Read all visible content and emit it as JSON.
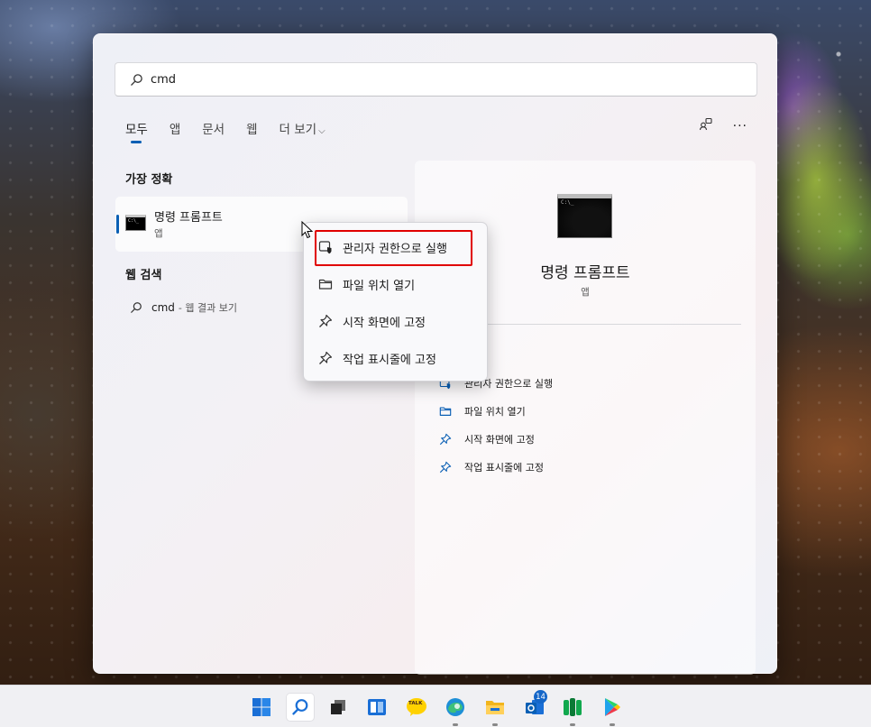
{
  "search": {
    "query": "cmd"
  },
  "tabs": [
    {
      "label": "모두",
      "active": true
    },
    {
      "label": "앱"
    },
    {
      "label": "문서"
    },
    {
      "label": "웹"
    },
    {
      "label": "더 보기",
      "chevron": "⌵"
    }
  ],
  "header_actions": {
    "share_icon": "share-icon",
    "more_label": "···"
  },
  "best_match": {
    "section_title": "가장 정확",
    "title": "명령 프롬프트",
    "subtitle": "앱",
    "icon_text": "C:\\_"
  },
  "web_search": {
    "section_title": "웹 검색",
    "query": "cmd",
    "suffix": "- 웹 결과 보기"
  },
  "preview": {
    "title": "명령 프롬프트",
    "subtitle": "앱",
    "icon_text": "C:\\_",
    "actions": [
      {
        "label": "관리자 권한으로 실행",
        "icon": "shield-icon"
      },
      {
        "label": "파일 위치 열기",
        "icon": "folder-icon"
      },
      {
        "label": "시작 화면에 고정",
        "icon": "pin-icon"
      },
      {
        "label": "작업 표시줄에 고정",
        "icon": "pin-icon"
      }
    ]
  },
  "context_menu": {
    "items": [
      {
        "label": "관리자 권한으로 실행",
        "icon": "shield-icon",
        "highlighted": true
      },
      {
        "label": "파일 위치 열기",
        "icon": "folder-icon"
      },
      {
        "label": "시작 화면에 고정",
        "icon": "pin-icon"
      },
      {
        "label": "작업 표시줄에 고정",
        "icon": "pin-icon"
      }
    ]
  },
  "taskbar": {
    "icons": [
      "start-icon",
      "search-icon",
      "task-view-icon",
      "widgets-icon",
      "kakaotalk-icon",
      "edge-icon",
      "file-explorer-icon",
      "outlook-icon",
      "line-icon",
      "play-store-icon"
    ],
    "kakaotalk_text": "TALK",
    "outlook_badge": "14"
  },
  "colors": {
    "accent": "#0a5fb4",
    "highlight_border": "#e00000"
  }
}
